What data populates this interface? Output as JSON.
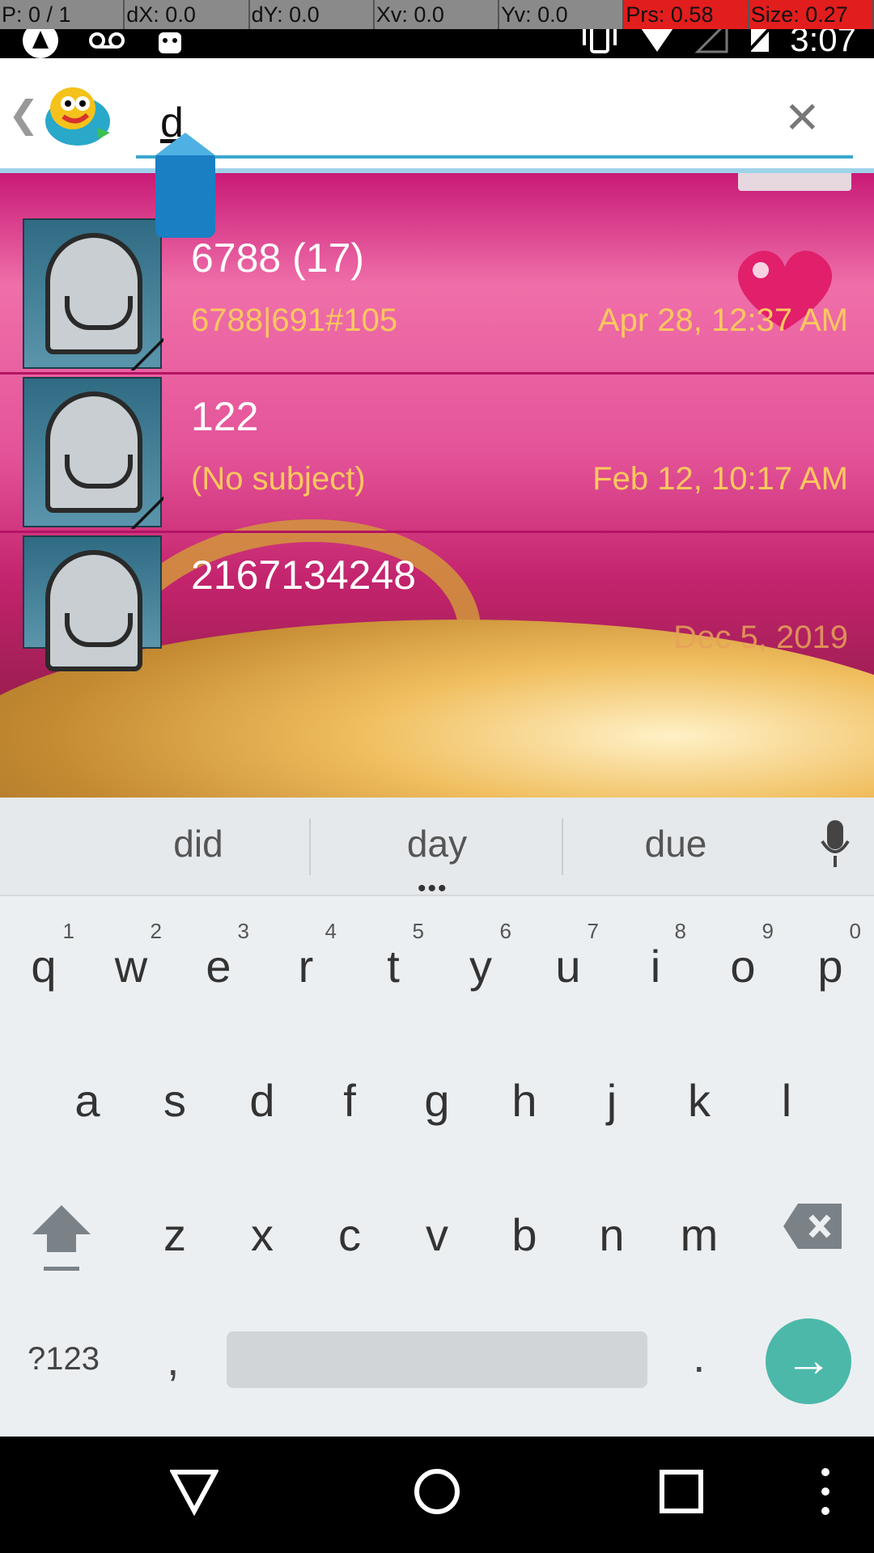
{
  "debug": {
    "pointer": "P: 0 / 1",
    "dx": "dX: 0.0",
    "dy": "dY: 0.0",
    "xv": "Xv: 0.0",
    "yv": "Yv: 0.0",
    "prs": "Prs: 0.58",
    "size": "Size: 0.27"
  },
  "status": {
    "time": "3:07"
  },
  "search": {
    "query": "d"
  },
  "conversations": [
    {
      "title": "6788 (17)",
      "subtitle": "6788|691#105",
      "date": "Apr 28, 12:37 AM"
    },
    {
      "title": "122",
      "subtitle": "(No subject)",
      "date": "Feb 12, 10:17 AM"
    },
    {
      "title": "2167134248",
      "subtitle": "",
      "date": "Dec 5, 2019"
    }
  ],
  "keyboard": {
    "suggestions": [
      "did",
      "day",
      "due"
    ],
    "row1": [
      {
        "c": "q",
        "n": "1"
      },
      {
        "c": "w",
        "n": "2"
      },
      {
        "c": "e",
        "n": "3"
      },
      {
        "c": "r",
        "n": "4"
      },
      {
        "c": "t",
        "n": "5"
      },
      {
        "c": "y",
        "n": "6"
      },
      {
        "c": "u",
        "n": "7"
      },
      {
        "c": "i",
        "n": "8"
      },
      {
        "c": "o",
        "n": "9"
      },
      {
        "c": "p",
        "n": "0"
      }
    ],
    "row2": [
      "a",
      "s",
      "d",
      "f",
      "g",
      "h",
      "j",
      "k",
      "l"
    ],
    "row3": [
      "z",
      "x",
      "c",
      "v",
      "b",
      "n",
      "m"
    ],
    "symbols": "?123",
    "comma": ",",
    "period": "."
  },
  "colors": {
    "accent": "#3ba7cf",
    "go_button": "#4bb8aa",
    "date_text": "#ffc85e"
  }
}
